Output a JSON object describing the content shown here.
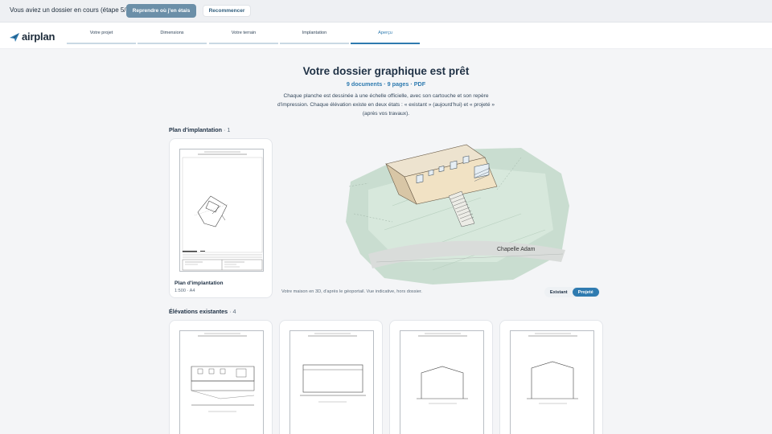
{
  "banner": {
    "text": "Vous aviez un dossier en cours (étape 5/5).",
    "resume_label": "Reprendre où j'en étais",
    "restart_label": "Recommencer"
  },
  "header": {
    "logo_text": "airplan",
    "steps": [
      {
        "label": "Votre projet"
      },
      {
        "label": "Dimensions"
      },
      {
        "label": "Votre terrain"
      },
      {
        "label": "Implantation"
      },
      {
        "label": "Aperçu",
        "active": true
      }
    ]
  },
  "main": {
    "title": "Votre dossier graphique est prêt",
    "subtitle": "9 documents · 9 pages · PDF",
    "description": "Chaque planche est dessinée à une échelle officielle, avec son cartouche et son repère d'impression. Chaque élévation existe en deux états : « existant » (aujourd'hui) et « projeté » (après vos travaux).",
    "plan_section": {
      "label": "Plan d'implantation",
      "count": "· 1"
    },
    "plan_card": {
      "name": "Plan d'implantation",
      "meta": "1:500 · A4"
    },
    "viewer": {
      "street_label": "Chapelle Adam",
      "caption": "Votre maison en 3D, d'après le géoportail. Vue indicative, hors dossier.",
      "toggle_existing": "Existant",
      "toggle_projected": "Projeté",
      "active_view": "Projeté"
    },
    "elevations_section": {
      "label": "Élévations existantes",
      "count": "· 4"
    }
  },
  "colors": {
    "accent": "#2f7bb0",
    "resume_button": "#6b8fa8",
    "background": "#f4f5f7"
  }
}
